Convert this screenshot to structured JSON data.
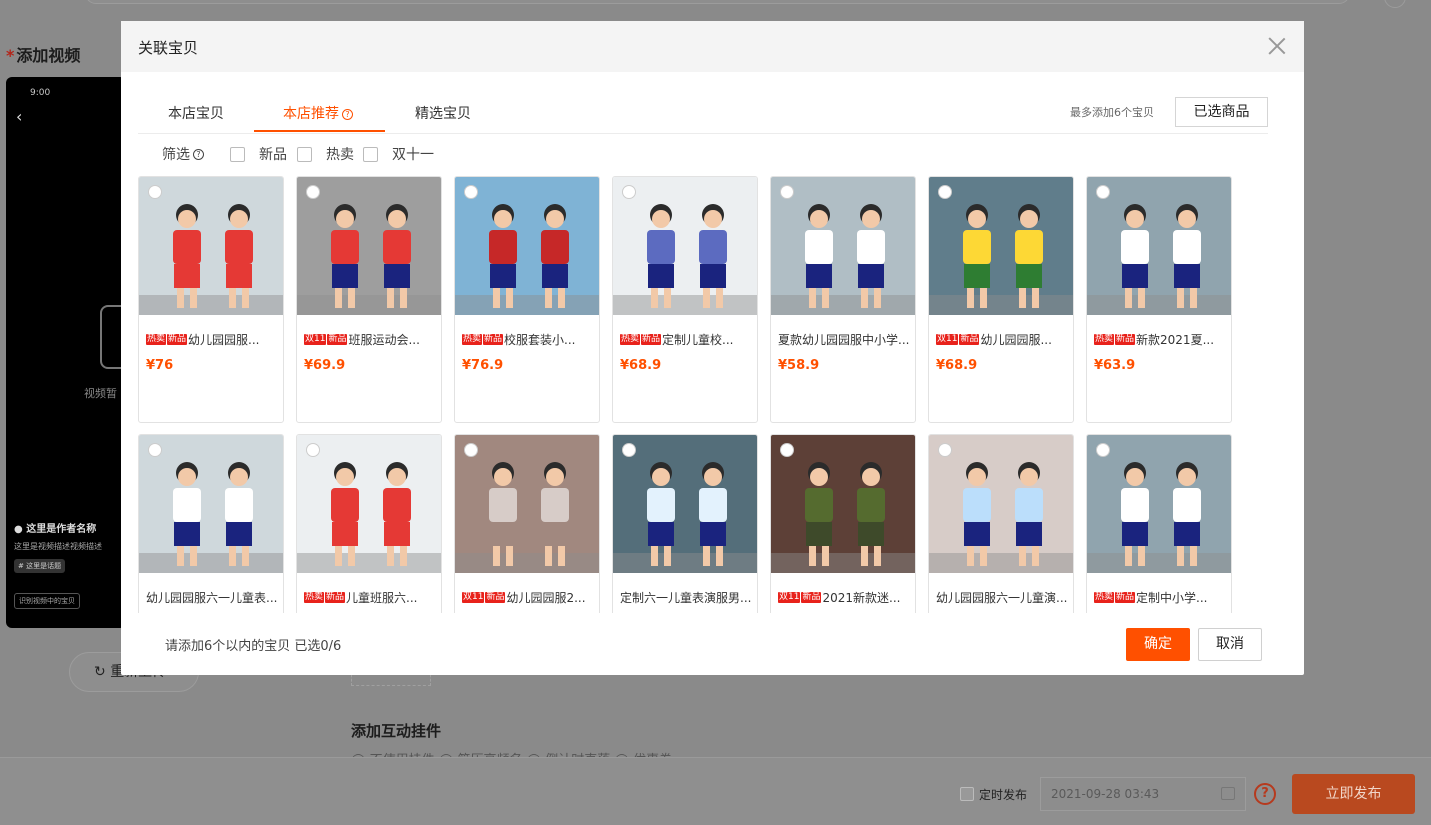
{
  "background": {
    "section_title": "添加视频",
    "phone": {
      "time": "9:00",
      "no_video_text": "视频暂",
      "author": "● 这里是作者名称",
      "description": "这里是视频描述视频描述",
      "hashtag": "# 这里是话题",
      "recognize_button": "识别视频中的宝贝"
    },
    "reupload_label": "重新上传",
    "widget_title": "添加互动挂件",
    "widget_options": "◯ 不使用挂件   ◯ 简历高频名   ◯ 倒计时直落   ◯ 优惠券",
    "schedule_label": "定时发布",
    "schedule_date": "2021-09-28 03:43",
    "publish_label": "立即发布",
    "help_glyph": "?"
  },
  "modal": {
    "title": "关联宝贝",
    "tabs": [
      {
        "label": "本店宝贝"
      },
      {
        "label": "本店推荐",
        "hint": "?"
      },
      {
        "label": "精选宝贝"
      }
    ],
    "limit_text": "最多添加6个宝贝",
    "selected_button": "已选商品",
    "filter": {
      "label": "筛选",
      "hint": "?",
      "options": [
        "新品",
        "热卖",
        "双十一"
      ]
    },
    "products": [
      {
        "badges": [
          "热卖",
          "新品"
        ],
        "name": "幼儿园园服...",
        "price": "¥76"
      },
      {
        "badges": [
          "双11",
          "新品"
        ],
        "name": "班服运动会...",
        "price": "¥69.9"
      },
      {
        "badges": [
          "热卖",
          "新品"
        ],
        "name": "校服套装小...",
        "price": "¥76.9"
      },
      {
        "badges": [
          "热卖",
          "新品"
        ],
        "name": "定制儿童校...",
        "price": "¥68.9"
      },
      {
        "badges": [],
        "name": "夏款幼儿园园服中小学...",
        "price": "¥58.9"
      },
      {
        "badges": [
          "双11",
          "新品"
        ],
        "name": "幼儿园园服...",
        "price": "¥68.9"
      },
      {
        "badges": [
          "热卖",
          "新品"
        ],
        "name": "新款2021夏...",
        "price": "¥63.9"
      },
      {
        "badges": [],
        "name": "幼儿园园服六一儿童表...",
        "price": ""
      },
      {
        "badges": [
          "热卖",
          "新品"
        ],
        "name": "儿童班服六...",
        "price": ""
      },
      {
        "badges": [
          "双11",
          "新品"
        ],
        "name": "幼儿园园服2...",
        "price": ""
      },
      {
        "badges": [],
        "name": "定制六一儿童表演服男...",
        "price": ""
      },
      {
        "badges": [
          "双11",
          "新品"
        ],
        "name": "2021新款迷...",
        "price": ""
      },
      {
        "badges": [],
        "name": "幼儿园园服六一儿童演...",
        "price": ""
      },
      {
        "badges": [
          "热卖",
          "新品"
        ],
        "name": "定制中小学...",
        "price": ""
      }
    ],
    "footer_text": "请添加6个以内的宝贝 已选0/6",
    "confirm_label": "确定",
    "cancel_label": "取消"
  },
  "colors": {
    "accent": "#ff5000",
    "badge": "#e8221b"
  }
}
